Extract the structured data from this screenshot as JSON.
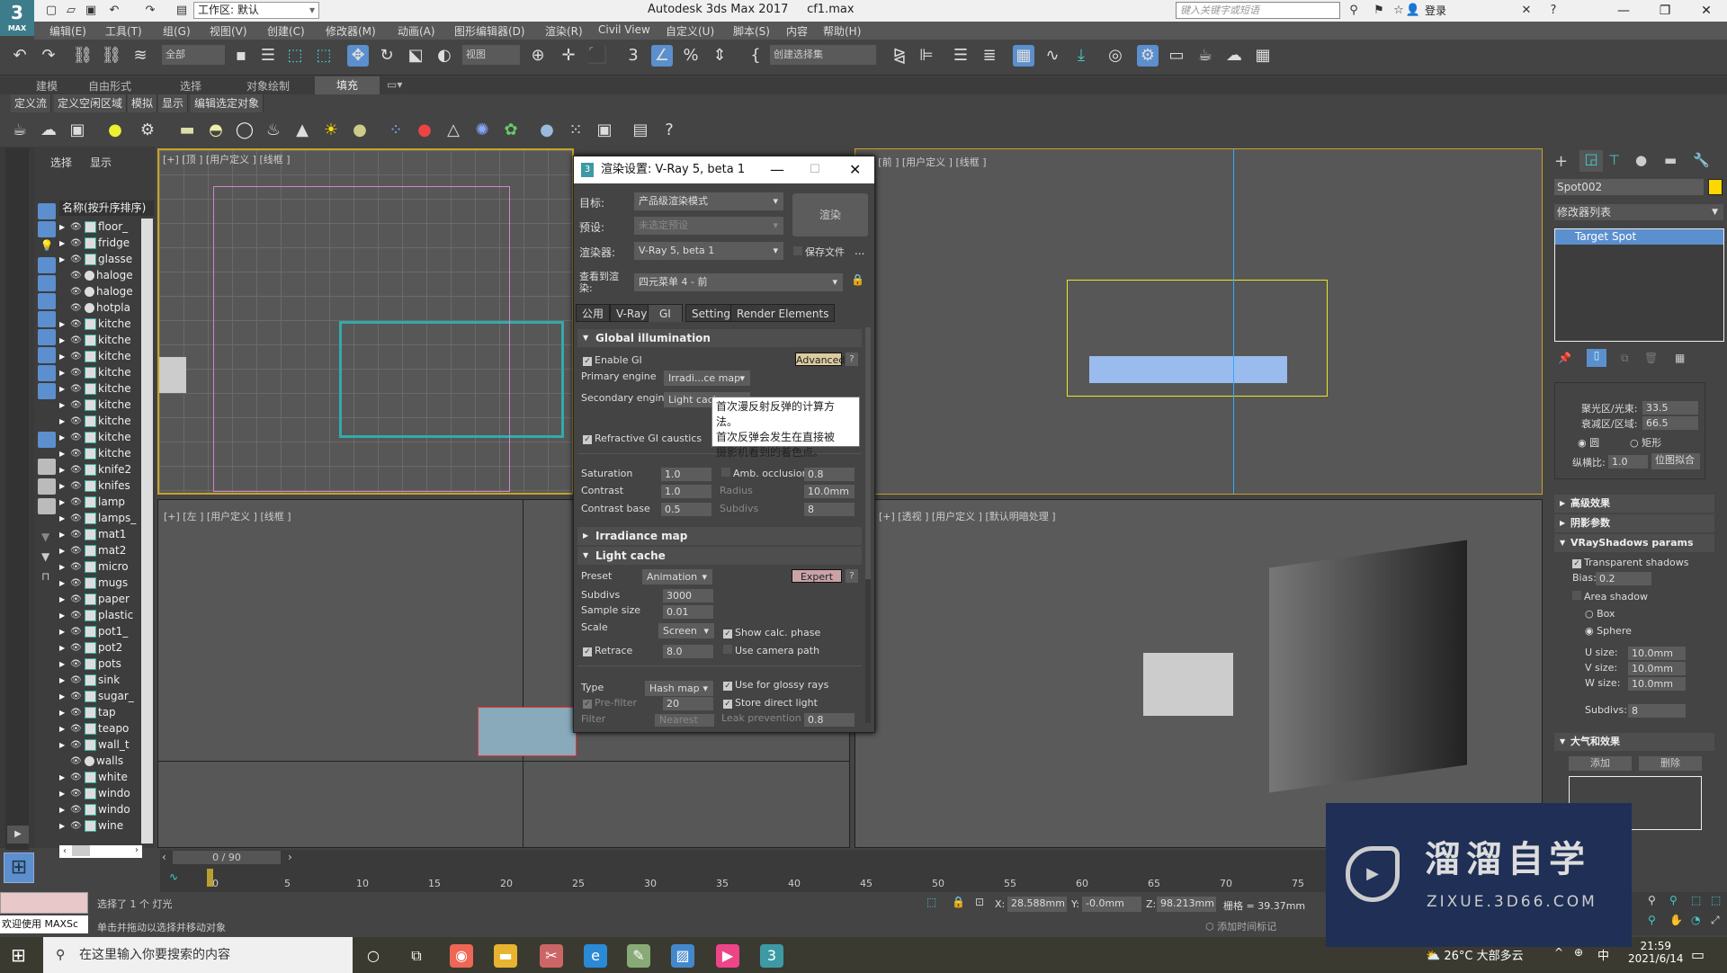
{
  "app": {
    "title": "Autodesk 3ds Max 2017",
    "file": "cf1.max",
    "logo": "3",
    "logo_sub": "MAX",
    "workspace": "工作区: 默认",
    "search_placeholder": "键入关键字或短语",
    "login": "登录"
  },
  "menu": [
    "编辑(E)",
    "工具(T)",
    "组(G)",
    "视图(V)",
    "创建(C)",
    "修改器(M)",
    "动画(A)",
    "图形编辑器(D)",
    "渲染(R)",
    "Civil View",
    "自定义(U)",
    "脚本(S)",
    "内容",
    "帮助(H)"
  ],
  "toolbar": {
    "filter": "全部",
    "view_dropdown": "视图",
    "selection_set": "创建选择集"
  },
  "ribbon": {
    "tabs": [
      "建模",
      "自由形式",
      "选择",
      "对象绘制",
      "填充"
    ],
    "active": "填充",
    "subtabs": [
      "定义流",
      "定义空闲区域",
      "模拟",
      "显示",
      "编辑选定对象"
    ]
  },
  "explorer": {
    "tabs": [
      "选择",
      "显示"
    ],
    "column_header": "名称(按升序排序)",
    "items": [
      {
        "name": "floor_",
        "type": "obj"
      },
      {
        "name": "fridge",
        "type": "obj"
      },
      {
        "name": "glasse",
        "type": "obj"
      },
      {
        "name": "haloge",
        "type": "light"
      },
      {
        "name": "haloge",
        "type": "light"
      },
      {
        "name": "hotpla",
        "type": "light"
      },
      {
        "name": "kitche",
        "type": "obj"
      },
      {
        "name": "kitche",
        "type": "obj"
      },
      {
        "name": "kitche",
        "type": "obj"
      },
      {
        "name": "kitche",
        "type": "obj"
      },
      {
        "name": "kitche",
        "type": "obj"
      },
      {
        "name": "kitche",
        "type": "obj"
      },
      {
        "name": "kitche",
        "type": "obj"
      },
      {
        "name": "kitche",
        "type": "obj"
      },
      {
        "name": "kitche",
        "type": "obj"
      },
      {
        "name": "knife2",
        "type": "obj"
      },
      {
        "name": "knifes",
        "type": "obj"
      },
      {
        "name": "lamp",
        "type": "obj"
      },
      {
        "name": "lamps_",
        "type": "obj"
      },
      {
        "name": "mat1",
        "type": "obj"
      },
      {
        "name": "mat2",
        "type": "obj"
      },
      {
        "name": "micro",
        "type": "obj"
      },
      {
        "name": "mugs",
        "type": "obj"
      },
      {
        "name": "paper",
        "type": "obj"
      },
      {
        "name": "plastic",
        "type": "obj"
      },
      {
        "name": "pot1_",
        "type": "obj"
      },
      {
        "name": "pot2",
        "type": "obj"
      },
      {
        "name": "pots",
        "type": "obj"
      },
      {
        "name": "sink",
        "type": "obj"
      },
      {
        "name": "sugar_",
        "type": "obj"
      },
      {
        "name": "tap",
        "type": "obj"
      },
      {
        "name": "teapo",
        "type": "obj"
      },
      {
        "name": "wall_t",
        "type": "obj"
      },
      {
        "name": "walls",
        "type": "light"
      },
      {
        "name": "white",
        "type": "obj"
      },
      {
        "name": "windo",
        "type": "obj"
      },
      {
        "name": "windo",
        "type": "obj"
      },
      {
        "name": "wine",
        "type": "obj"
      }
    ]
  },
  "viewports": {
    "top": "[+] [顶 ] [用户定义 ] [线框 ]",
    "front": "[+] [前 ] [用户定义 ] [线框 ]",
    "left": "[+] [左 ] [用户定义 ] [线框 ]",
    "persp": "[+] [透视 ] [用户定义 ] [默认明暗处理 ]"
  },
  "dialog": {
    "title": "渲染设置: V-Ray 5, beta 1",
    "target_label": "目标:",
    "target_value": "产品级渲染模式",
    "preset_label": "预设:",
    "preset_value": "未选定预设",
    "renderer_label": "渲染器:",
    "renderer_value": "V-Ray 5, beta 1",
    "save_file": "保存文件",
    "more": "...",
    "view_label": "查看到渲染:",
    "view_value": "四元菜单 4 - 前",
    "render_button": "渲染",
    "tabs": [
      "公用",
      "V-Ray",
      "GI",
      "Settings",
      "Render Elements"
    ],
    "active_tab": "GI",
    "gi": {
      "section": "Global illumination",
      "enable_gi": "Enable GI",
      "advanced": "Advanced",
      "help": "?",
      "primary_label": "Primary engine",
      "primary_value": "Irradi...ce map",
      "secondary_label": "Secondary engine",
      "secondary_value": "Light cache",
      "refractive": "Refractive GI caustics",
      "saturation_label": "Saturation",
      "saturation": "1.0",
      "contrast_label": "Contrast",
      "contrast": "1.0",
      "contrast_base_label": "Contrast base",
      "contrast_base": "0.5",
      "amb_label": "Amb. occlusion",
      "amb": "0.8",
      "radius_label": "Radius",
      "radius": "10.0mm",
      "subdivs_label": "Subdivs",
      "subdivs": "8"
    },
    "tooltip": [
      "首次漫反射反弹的计算方法。",
      "首次反弹会发生在直接被",
      "摄影机看到的着色点。"
    ],
    "irradiance_section": "Irradiance map",
    "lc": {
      "section": "Light cache",
      "preset_label": "Preset",
      "preset": "Animation",
      "expert": "Expert",
      "subdivs_label": "Subdivs",
      "subdivs": "3000",
      "sample_label": "Sample size",
      "sample": "0.01",
      "scale_label": "Scale",
      "scale": "Screen",
      "show_calc": "Show calc. phase",
      "retrace_label": "Retrace",
      "retrace": "8.0",
      "camera_path": "Use camera path",
      "type_label": "Type",
      "type": "Hash map",
      "glossy": "Use for glossy rays",
      "prefilter_label": "Pre-filter",
      "prefilter": "20",
      "store_direct": "Store direct light",
      "filter_label": "Filter",
      "filter": "Nearest",
      "leak_label": "Leak prevention",
      "leak": "0.8"
    }
  },
  "rpanel": {
    "object_name": "Spot002",
    "object_color": "#ffd700",
    "modifier_list": "修改器列表",
    "stack_item": "Target Spot",
    "hotspot_label": "聚光区/光束:",
    "hotspot": "33.5",
    "falloff_label": "衰减区/区域:",
    "falloff": "66.5",
    "circle": "圆",
    "rect": "矩形",
    "aspect_label": "纵横比:",
    "aspect": "1.0",
    "bitmap_fit": "位图拟合",
    "adv_effects": "高级效果",
    "shadow_params": "阴影参数",
    "vray_shadows": "VRayShadows params",
    "transparent": "Transparent shadows",
    "bias_label": "Bias:",
    "bias": "0.2",
    "area_shadow": "Area shadow",
    "box": "Box",
    "sphere": "Sphere",
    "u_label": "U size:",
    "u": "10.0mm",
    "v_label": "V size:",
    "v": "10.0mm",
    "w_label": "W size:",
    "w": "10.0mm",
    "subdivs_label": "Subdivs:",
    "subdivs": "8",
    "atmos": "大气和效果",
    "add": "添加",
    "delete": "删除"
  },
  "timeline": {
    "frame": "0 / 90",
    "ticks": [
      "0",
      "5",
      "10",
      "15",
      "20",
      "25",
      "30",
      "35",
      "40",
      "45",
      "50",
      "55",
      "60",
      "65",
      "70",
      "75"
    ]
  },
  "status": {
    "maxscript": "欢迎使用 MAXSc",
    "line1": "选择了 1 个 灯光",
    "line2": "单击并拖动以选择并移动对象",
    "x_label": "X:",
    "x": "28.588mm",
    "y_label": "Y:",
    "y": "-0.0mm",
    "z_label": "Z:",
    "z": "98.213mm",
    "grid": "栅格 = 39.37mm",
    "add_time_tag": "添加时间标记"
  },
  "taskbar": {
    "search": "在这里输入你要搜索的内容",
    "weather": "26°C 大部多云",
    "ime": "中",
    "time": "21:59",
    "date": "2021/6/14"
  },
  "watermark": {
    "title": "溜溜自学",
    "url": "ZIXUE.3D66.COM"
  }
}
